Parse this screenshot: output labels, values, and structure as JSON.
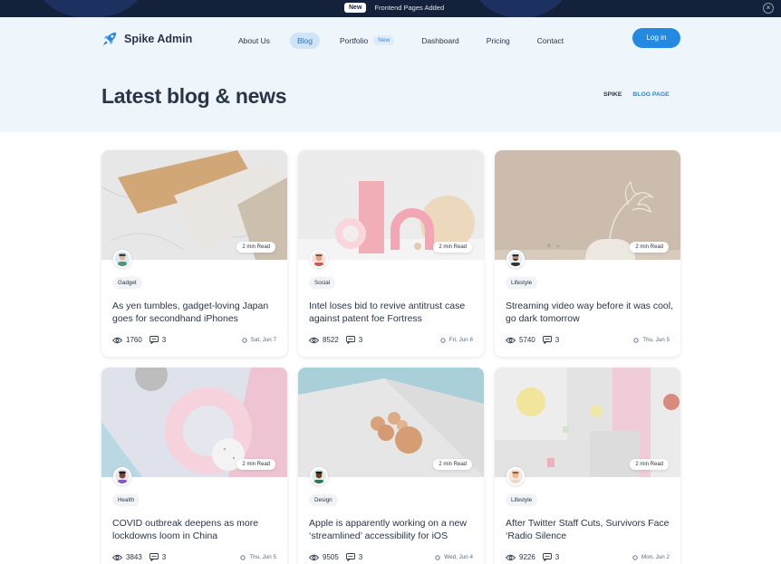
{
  "announcement": {
    "badge": "New",
    "message": "Frontend Pages Added"
  },
  "brand": {
    "name": "Spike Admin"
  },
  "nav": {
    "items": [
      {
        "label": "About Us"
      },
      {
        "label": "Blog"
      },
      {
        "label": "Portfolio",
        "pill": "New"
      },
      {
        "label": "Dashboard"
      },
      {
        "label": "Pricing"
      },
      {
        "label": "Contact"
      }
    ],
    "active": "Blog",
    "login": "Log in"
  },
  "page": {
    "title": "Latest blog & news",
    "breadcrumb": [
      "SPIKE",
      "BLOG PAGE"
    ]
  },
  "posts": [
    {
      "read": "2 min Read",
      "tag": "Gadget",
      "title": "As yen tumbles, gadget-loving Japan goes for secondhand iPhones",
      "views": "1760",
      "comments": "3",
      "date": "Sat, Jun 7"
    },
    {
      "read": "2 min Read",
      "tag": "Social",
      "title": "Intel loses bid to revive antitrust case against patent foe Fortress",
      "views": "8522",
      "comments": "3",
      "date": "Fri, Jun 6"
    },
    {
      "read": "2 min Read",
      "tag": "Lifestyle",
      "title": "Streaming video way before it was cool, go dark tomorrow",
      "views": "5740",
      "comments": "3",
      "date": "Thu, Jun 5"
    },
    {
      "read": "2 min Read",
      "tag": "Health",
      "title": "COVID outbreak deepens as more lockdowns loom in China",
      "views": "3843",
      "comments": "3",
      "date": "Thu, Jun 5"
    },
    {
      "read": "2 min Read",
      "tag": "Design",
      "title": "Apple is apparently working on a new ‘streamlined’ accessibility for iOS",
      "views": "9505",
      "comments": "3",
      "date": "Wed, Jun 4"
    },
    {
      "read": "2 min Read",
      "tag": "Lifestyle",
      "title": "After Twitter Staff Cuts, Survivors Face ‘Radio Silence",
      "views": "9226",
      "comments": "3",
      "date": "Mon, Jun 2"
    }
  ],
  "colors": {
    "accent": "#2389e1",
    "dark": "#14213a",
    "heroBg": "#eef5fb",
    "text": "#2a3547"
  }
}
